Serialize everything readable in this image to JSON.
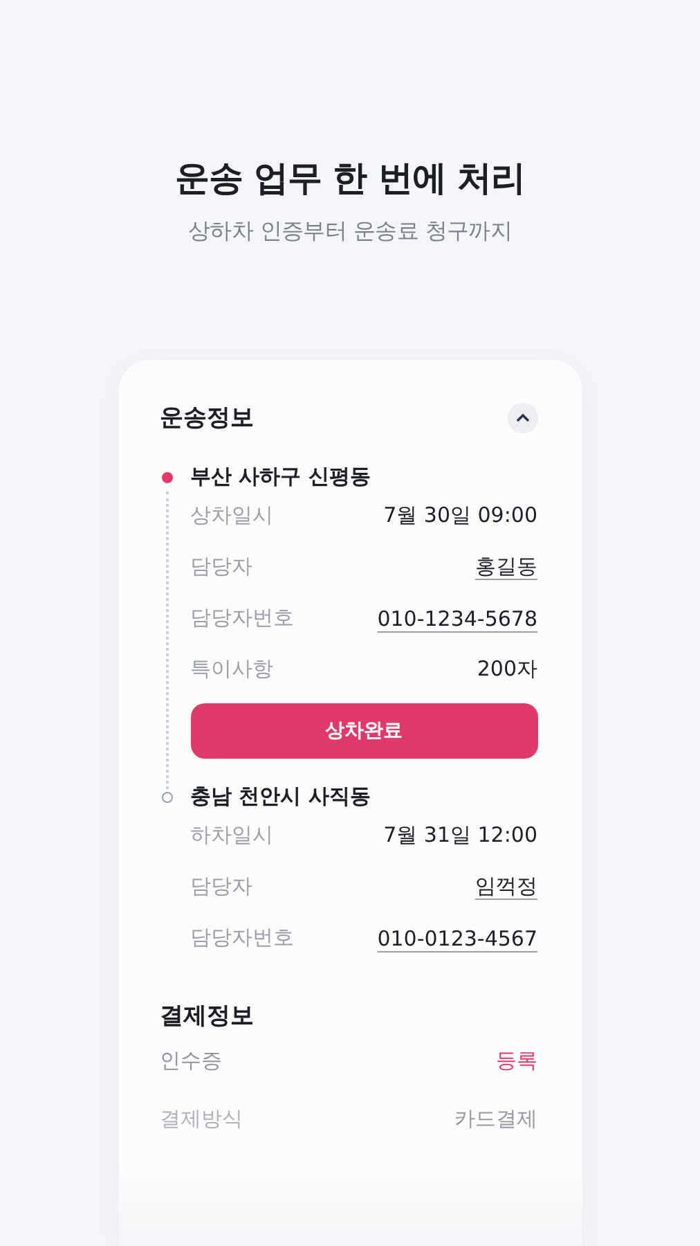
{
  "headline": {
    "title": "운송 업무 한 번에 처리",
    "subtitle": "상하차 인증부터 운송료 청구까지"
  },
  "transport": {
    "title": "운송정보",
    "expanded": true,
    "stops": [
      {
        "kind": "pickup",
        "place": "부산 사하구 신평동",
        "rows": [
          {
            "label": "상차일시",
            "value": "7월 30일 09:00",
            "link": false
          },
          {
            "label": "담당자",
            "value": "홍길동",
            "link": true
          },
          {
            "label": "담당자번호",
            "value": "010-1234-5678",
            "link": true
          },
          {
            "label": "특이사항",
            "value": "200자",
            "link": false
          }
        ],
        "button": "상차완료"
      },
      {
        "kind": "dropoff",
        "place": "충남 천안시 사직동",
        "rows": [
          {
            "label": "하차일시",
            "value": "7월 31일 12:00",
            "link": false
          },
          {
            "label": "담당자",
            "value": "임꺽정",
            "link": true
          },
          {
            "label": "담당자번호",
            "value": "010-0123-4567",
            "link": true
          }
        ]
      }
    ]
  },
  "payment": {
    "title": "결제정보",
    "rows": [
      {
        "label": "인수증",
        "value": "등록",
        "kind": "action",
        "faded": false
      },
      {
        "label": "결제방식",
        "value": "카드결제",
        "kind": "plain",
        "faded": true
      }
    ]
  }
}
